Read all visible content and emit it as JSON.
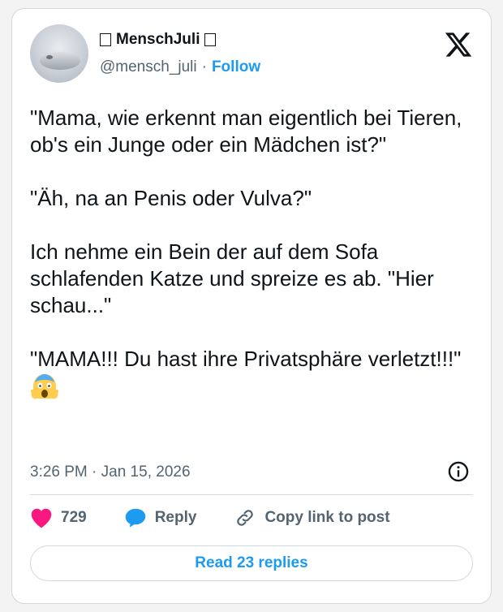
{
  "user": {
    "display_name": "MenschJuli",
    "handle": "@mensch_juli",
    "separator": "·",
    "follow_label": "Follow"
  },
  "tweet": {
    "text": "\"Mama, wie erkennt man eigentlich bei Tieren, ob's ein Junge oder ein Mädchen ist?\"\n\n\"Äh, na an Penis oder Vulva?\"\n\nIch nehme ein Bein der auf dem Sofa schlafenden Katze und spreize es ab. \"Hier schau...\"\n\n\"MAMA!!! Du hast ihre Privatsphäre verletzt!!!\"",
    "emoji_icon": "face-screaming-in-fear-icon",
    "timestamp": "3:26 PM · Jan 15, 2026"
  },
  "actions": {
    "like_count": "729",
    "reply_label": "Reply",
    "copy_link_label": "Copy link to post"
  },
  "read_replies_label": "Read 23 replies",
  "colors": {
    "accent": "#1d9bf0",
    "like": "#f91880",
    "text": "#0f1419",
    "secondary": "#536471",
    "border": "#cfd9de"
  }
}
